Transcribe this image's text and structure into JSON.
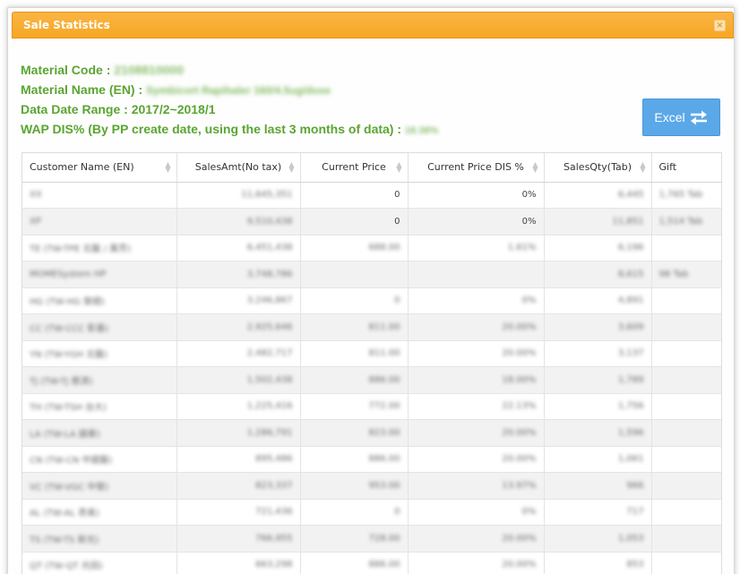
{
  "dialog": {
    "title": "Sale Statistics",
    "close_label": "×"
  },
  "info": {
    "material_code_label": "Material Code : ",
    "material_code_value": "2108810000",
    "material_name_label": "Material Name (EN) : ",
    "material_name_value": "Symbicort Rapihaler 160/4.5ug/dose",
    "date_range_label": "Data Date Range : ",
    "date_range_value": "2017/2~2018/1",
    "wap_label": "WAP DIS% (By PP create date, using the last 3 months of data) : ",
    "wap_value": "18.38%"
  },
  "excel_button": {
    "label": "Excel",
    "icon": "transfer-arrows-icon"
  },
  "table": {
    "columns": [
      "Customer Name (EN)",
      "SalesAmt(No tax)",
      "Current Price",
      "Current Price DIS %",
      "SalesQty(Tab)",
      "Gift"
    ],
    "rows": [
      [
        "XX",
        "11,645,351",
        "0",
        "0%",
        "6,445",
        "1,765 Tab"
      ],
      [
        "XP",
        "9,510,438",
        "0",
        "0%",
        "11,851",
        "1,514 Tab"
      ],
      [
        "TE (TW-TPE 北醫 / 萬芳)",
        "6,451,438",
        "688.00",
        "1.61%",
        "6,196",
        ""
      ],
      [
        "MOMESystem HP",
        "3,748,786",
        "",
        "",
        "8,615",
        "98 Tab"
      ],
      [
        "HG (TW-HG 榮總)",
        "3,246,867",
        "0",
        "0%",
        "4,891",
        ""
      ],
      [
        "CC (TW-CCC 彰基)",
        "2,925,646",
        "811.00",
        "20.00%",
        "3,609",
        ""
      ],
      [
        "YN (TW-YGH 北醫)",
        "2,482,717",
        "811.00",
        "20.00%",
        "3,137",
        ""
      ],
      [
        "TJ (TW-TJ 慈濟)",
        "1,502,438",
        "886.00",
        "18.00%",
        "1,789",
        ""
      ],
      [
        "TH (TW-TSH 台大)",
        "1,225,416",
        "772.00",
        "22.13%",
        "1,756",
        ""
      ],
      [
        "LA (TW-LA 國泰)",
        "1,286,791",
        "823.00",
        "20.00%",
        "1,596",
        ""
      ],
      [
        "CN (TW-CN 中國醫)",
        "895,486",
        "886.00",
        "20.00%",
        "1,061",
        ""
      ],
      [
        "VC (TW-VGC 中榮)",
        "823,337",
        "953.00",
        "13.97%",
        "966",
        ""
      ],
      [
        "AL (TW-AL 奇美)",
        "721,436",
        "0",
        "0%",
        "717",
        ""
      ],
      [
        "TS (TW-TS 新光)",
        "766,955",
        "728.00",
        "20.00%",
        "1,053",
        ""
      ],
      [
        "QT (TW-QT 光田)",
        "663,298",
        "886.00",
        "20.00%",
        "853",
        ""
      ]
    ]
  },
  "colors": {
    "title_bar": "#f6a623",
    "info_text": "#5aa531",
    "excel_button": "#5aa8e8"
  }
}
